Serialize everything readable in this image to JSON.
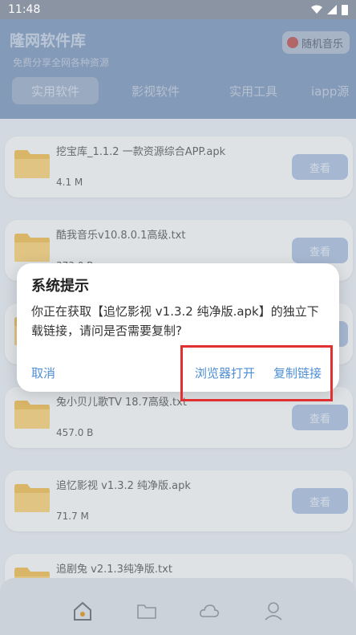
{
  "status_bar": {
    "time": "11:48"
  },
  "header": {
    "title": "隆网软件库",
    "subtitle": "免费分享全网各种资源",
    "random_music": "随机音乐",
    "tabs": [
      "实用软件",
      "影视软件",
      "实用工具",
      "iapp源"
    ]
  },
  "files": [
    {
      "name": "挖宝库_1.1.2 一款资源综合APP.apk",
      "size": "4.1 M",
      "action": "查看"
    },
    {
      "name": "酷我音乐v10.8.0.1高级.txt",
      "size": "373.0 B",
      "action": "查看"
    },
    {
      "name": "",
      "size": "",
      "action": "查看"
    },
    {
      "name": "兔小贝儿歌TV 18.7高级.txt",
      "size": "457.0 B",
      "action": "查看"
    },
    {
      "name": "追忆影视 v1.3.2 纯净版.apk",
      "size": "71.7 M",
      "action": "查看"
    },
    {
      "name": "追剧兔 v2.1.3纯净版.txt",
      "size": "",
      "action": ""
    }
  ],
  "dialog": {
    "title": "系统提示",
    "message": "你正在获取【追忆影视 v1.3.2 纯净版.apk】的独立下载链接，请问是否需要复制?",
    "cancel": "取消",
    "open_browser": "浏览器打开",
    "copy_link": "复制链接"
  },
  "colors": {
    "accent": "#4f8fd6",
    "header": "#8fa6c6",
    "highlight": "#e03030"
  },
  "bottom_nav": [
    "home-icon",
    "folder-icon",
    "cloud-icon",
    "user-icon"
  ]
}
